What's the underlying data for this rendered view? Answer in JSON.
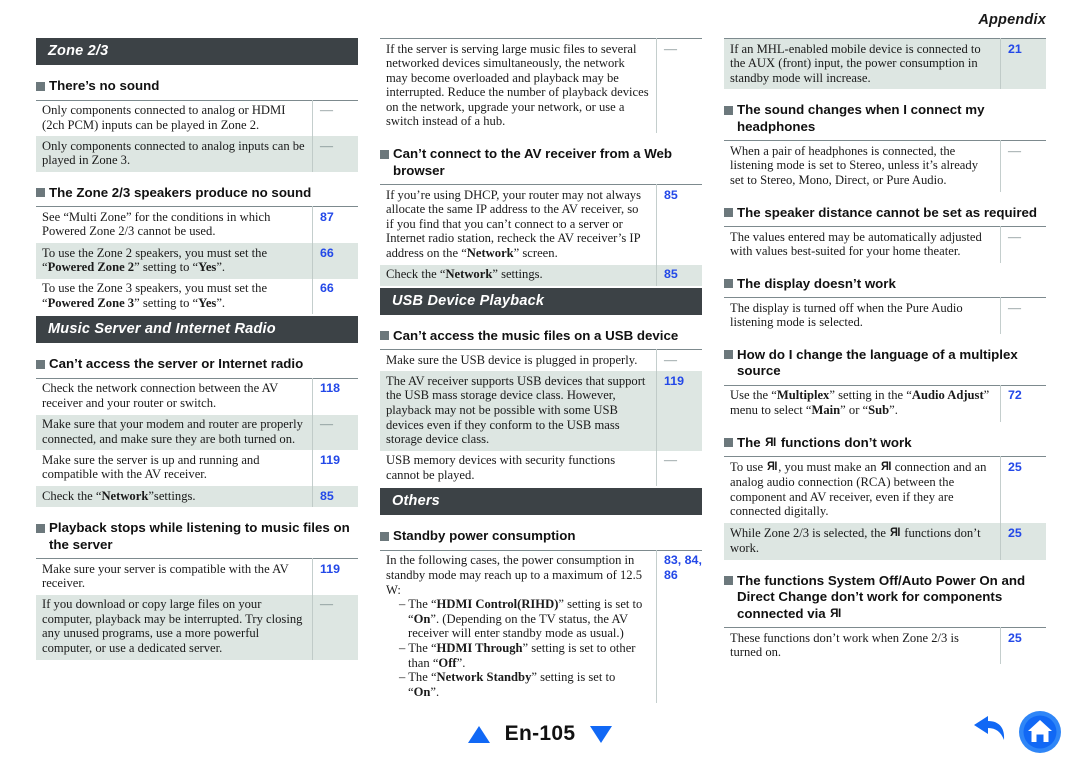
{
  "header": {
    "title": "Appendix"
  },
  "colors": {
    "section_bar": "#3c4246",
    "bullet": "#6c787c",
    "row_shade": "#dde6e2",
    "page_link": "#2348e8",
    "nav_blue": "#1168f5"
  },
  "footer": {
    "page_label": "En-105",
    "prev_icon": "triangle-up-icon",
    "next_icon": "triangle-down-icon",
    "back_icon": "back-arrow-icon",
    "home_icon": "home-icon"
  },
  "columns": [
    {
      "blocks": [
        {
          "kind": "section",
          "label": "Zone 2/3"
        },
        {
          "kind": "question",
          "label": "There’s no sound"
        },
        {
          "kind": "table",
          "rows": [
            {
              "shade": false,
              "page": "—",
              "dash": true,
              "html": "Only components connected to analog or HDMI (2ch PCM) inputs can be played in Zone 2."
            },
            {
              "shade": true,
              "page": "—",
              "dash": true,
              "html": "Only components connected to analog inputs can be played in Zone 3."
            }
          ]
        },
        {
          "kind": "question",
          "label": "The Zone 2/3 speakers produce no sound"
        },
        {
          "kind": "table",
          "rows": [
            {
              "shade": false,
              "page": "87",
              "dash": false,
              "html": "See “Multi Zone” for the conditions in which Powered Zone 2/3 cannot be used."
            },
            {
              "shade": true,
              "page": "66",
              "dash": false,
              "html": "To use the Zone 2 speakers, you must set the “<b>Powered Zone 2</b>” setting to “<b>Yes</b>”."
            },
            {
              "shade": false,
              "page": "66",
              "dash": false,
              "html": "To use the Zone 3 speakers, you must set the “<b>Powered Zone 3</b>” setting to “<b>Yes</b>”."
            }
          ]
        },
        {
          "kind": "section",
          "label": "Music Server and Internet Radio"
        },
        {
          "kind": "question",
          "label": "Can’t access the server or Internet radio"
        },
        {
          "kind": "table",
          "rows": [
            {
              "shade": false,
              "page": "118",
              "dash": false,
              "html": "Check the network connection between the AV receiver and your router or switch."
            },
            {
              "shade": true,
              "page": "—",
              "dash": true,
              "html": "Make sure that your modem and router are properly connected, and make sure they are both turned on."
            },
            {
              "shade": false,
              "page": "119",
              "dash": false,
              "html": "Make sure the server is up and running and compatible with the AV receiver."
            },
            {
              "shade": true,
              "page": "85",
              "dash": false,
              "html": "Check the “<b>Network</b>”settings."
            }
          ]
        },
        {
          "kind": "question",
          "label": "Playback stops while listening to music files on the server"
        },
        {
          "kind": "table",
          "rows": [
            {
              "shade": false,
              "page": "119",
              "dash": false,
              "html": "Make sure your server is compatible with the AV receiver."
            },
            {
              "shade": true,
              "page": "—",
              "dash": true,
              "html": "If you download or copy large files on your computer, playback may be interrupted. Try closing any unused programs, use a more powerful computer, or use a dedicated server."
            }
          ]
        }
      ]
    },
    {
      "blocks": [
        {
          "kind": "table",
          "top_rule": true,
          "rows": [
            {
              "shade": false,
              "page": "—",
              "dash": true,
              "html": "If the server is serving large music files to several networked devices simultaneously, the network may become overloaded and playback may be interrupted. Reduce the number of playback devices on the network, upgrade your network, or use a switch instead of a hub."
            }
          ]
        },
        {
          "kind": "question",
          "label": "Can’t connect to the AV receiver from a Web browser"
        },
        {
          "kind": "table",
          "rows": [
            {
              "shade": false,
              "page": "85",
              "dash": false,
              "html": "If you’re using DHCP, your router may not always allocate the same IP address to the AV receiver, so if you find that you can’t connect to a server or Internet radio station, recheck the AV receiver’s IP address on the “<b>Network</b>” screen."
            },
            {
              "shade": true,
              "page": "85",
              "dash": false,
              "html": "Check the “<b>Network</b>” settings."
            }
          ]
        },
        {
          "kind": "section",
          "label": "USB Device Playback"
        },
        {
          "kind": "question",
          "label": "Can’t access the music files on a USB device"
        },
        {
          "kind": "table",
          "rows": [
            {
              "shade": false,
              "page": "—",
              "dash": true,
              "html": "Make sure the USB device is plugged in properly."
            },
            {
              "shade": true,
              "page": "119",
              "dash": false,
              "html": "The AV receiver supports USB devices that support the USB mass storage device class. However, playback may not be possible with some USB devices even if they conform to the USB mass storage device class."
            },
            {
              "shade": false,
              "page": "—",
              "dash": true,
              "html": "USB memory devices with security functions cannot be played."
            }
          ]
        },
        {
          "kind": "section",
          "label": "Others"
        },
        {
          "kind": "question",
          "label": "Standby power consumption"
        },
        {
          "kind": "table",
          "rows": [
            {
              "shade": false,
              "page": "83, 84, 86",
              "dash": false,
              "html": "In the following cases, the power consumption in standby mode may reach up to a maximum of 12.5 W:<ul class=\"sub\"><li>– The “<b>HDMI Control(RIHD)</b>” setting is set to “<b>On</b>”. (Depending on the TV status, the AV receiver will enter standby mode as usual.)</li><li>– The “<b>HDMI Through</b>” setting is set to other than “<b>Off</b>”.</li><li>– The “<b>Network Standby</b>” setting is set to “<b>On</b>”.</li></ul>"
            }
          ]
        }
      ]
    },
    {
      "blocks": [
        {
          "kind": "table",
          "top_rule": true,
          "rows": [
            {
              "shade": true,
              "page": "21",
              "dash": false,
              "html": "If an MHL-enabled mobile device is connected to the AUX (front) input, the power consumption in standby mode will increase."
            }
          ]
        },
        {
          "kind": "question",
          "label": "The sound changes when I connect my headphones"
        },
        {
          "kind": "table",
          "rows": [
            {
              "shade": false,
              "page": "—",
              "dash": true,
              "html": "When a pair of headphones is connected, the listening mode is set to Stereo, unless it’s already set to Stereo, Mono, Direct, or Pure Audio."
            }
          ]
        },
        {
          "kind": "question",
          "label": "The speaker distance cannot be set as required"
        },
        {
          "kind": "table",
          "rows": [
            {
              "shade": false,
              "page": "—",
              "dash": true,
              "html": "The values entered may be automatically adjusted with values best-suited for your home theater."
            }
          ]
        },
        {
          "kind": "question",
          "label": "The display doesn’t work"
        },
        {
          "kind": "table",
          "rows": [
            {
              "shade": false,
              "page": "—",
              "dash": true,
              "html": "The display is turned off when the Pure Audio listening mode is selected."
            }
          ]
        },
        {
          "kind": "question",
          "label": "How do I change the language of a multiplex source"
        },
        {
          "kind": "table",
          "rows": [
            {
              "shade": false,
              "page": "72",
              "dash": false,
              "html": "Use the “<b>Multiplex</b>” setting in the “<b>Audio Adjust</b>” menu to select “<b>Main</b>” or “<b>Sub</b>”."
            }
          ]
        },
        {
          "kind": "question",
          "label_html": "The <span class=\"ri\"><span class=\"rchar\">R</span>I</span> functions don’t work"
        },
        {
          "kind": "table",
          "rows": [
            {
              "shade": false,
              "page": "25",
              "dash": false,
              "html": "To use <span class=\"ri\"><span class=\"rchar\">R</span>I</span>, you must make an <span class=\"ri\"><span class=\"rchar\">R</span>I</span> connection and an analog audio connection (RCA) between the component and AV receiver, even if they are connected digitally."
            },
            {
              "shade": true,
              "page": "25",
              "dash": false,
              "html": "While Zone 2/3 is selected, the <span class=\"ri\"><span class=\"rchar\">R</span>I</span> functions don’t work."
            }
          ]
        },
        {
          "kind": "question",
          "label_html": "The functions System Off/Auto Power On and Direct Change don’t work for components connected via <span class=\"ri\"><span class=\"rchar\">R</span>I</span>"
        },
        {
          "kind": "table",
          "rows": [
            {
              "shade": false,
              "page": "25",
              "dash": false,
              "html": "These functions don’t work when Zone 2/3 is turned on."
            }
          ]
        }
      ]
    }
  ]
}
